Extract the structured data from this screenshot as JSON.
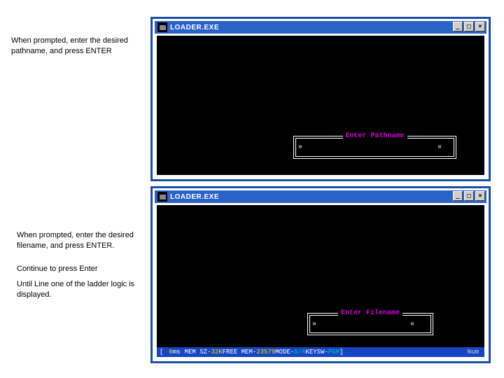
{
  "captions": {
    "c1": "When prompted, enter the desired pathname, and press ENTER",
    "c2": "When prompted, enter the desired filename, and press ENTER.",
    "c3": "Continue to press Enter",
    "c4": "Until Line one of the ladder logic is displayed."
  },
  "win1": {
    "title": "LOADER.EXE",
    "btns": {
      "min": "_",
      "max": "□",
      "close": "×"
    },
    "prompt": {
      "title": "Enter Pathname",
      "ql": "»",
      "qr": "«",
      "value": ""
    }
  },
  "win2": {
    "title": "LOADER.EXE",
    "btns": {
      "min": "_",
      "max": "□",
      "close": "×"
    },
    "prompt": {
      "title": "Enter Filename",
      "ql": "»",
      "qr": "«",
      "value": ""
    },
    "status": {
      "lb": "[",
      "ms_val": "0",
      "ms_label": " ms",
      "memsz_label": "MEM SZ-",
      "memsz_val": " 32K",
      "freemem_label": " FREE MEM-",
      "freemem_val": " 23579",
      "mode_label": " MODE-",
      "mode_val": "S/A",
      "keysw_label": " KEYSW-",
      "keysw_val": "PGM",
      "rb": "]",
      "num": "Num"
    }
  }
}
